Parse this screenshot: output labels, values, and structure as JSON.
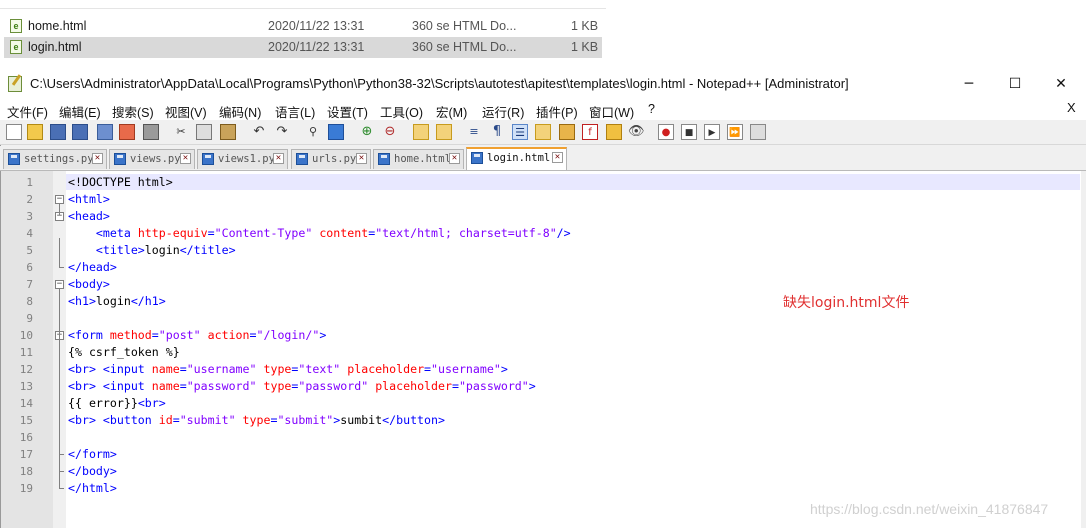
{
  "explorer": {
    "rows": [
      {
        "name": "home.html",
        "date": "2020/11/22 13:31",
        "type": "360 se HTML Do...",
        "size": "1 KB",
        "selected": false
      },
      {
        "name": "login.html",
        "date": "2020/11/22 13:31",
        "type": "360 se HTML Do...",
        "size": "1 KB",
        "selected": true
      }
    ],
    "file_icon_glyph": "e"
  },
  "window": {
    "title": "C:\\Users\\Administrator\\AppData\\Local\\Programs\\Python\\Python38-32\\Scripts\\autotest\\apitest\\templates\\login.html - Notepad++ [Administrator]",
    "minimize": "─",
    "maximize": "☐",
    "close": "✕"
  },
  "menu": {
    "items": [
      "文件(F)",
      "编辑(E)",
      "搜索(S)",
      "视图(V)",
      "编码(N)",
      "语言(L)",
      "设置(T)",
      "工具(O)",
      "宏(M)",
      "运行(R)",
      "插件(P)",
      "窗口(W)",
      "?"
    ],
    "close_label": "X"
  },
  "tabs": [
    {
      "label": "settings.py",
      "active": false
    },
    {
      "label": "views.py",
      "active": false
    },
    {
      "label": "views1.py",
      "active": false
    },
    {
      "label": "urls.py",
      "active": false
    },
    {
      "label": "home.html",
      "active": false
    },
    {
      "label": "login.html",
      "active": true
    }
  ],
  "tab_close_glyph": "✕",
  "editor": {
    "line_numbers": [
      "1",
      "2",
      "3",
      "4",
      "5",
      "6",
      "7",
      "8",
      "9",
      "10",
      "11",
      "12",
      "13",
      "14",
      "15",
      "16",
      "17",
      "18",
      "19"
    ],
    "lines": [
      [
        [
          "doc",
          "<!DOCTYPE html>"
        ]
      ],
      [
        [
          "tag",
          "<html>"
        ]
      ],
      [
        [
          "tag",
          "<head>"
        ]
      ],
      [
        [
          "txt",
          "    "
        ],
        [
          "tag",
          "<meta "
        ],
        [
          "attr",
          "http-equiv"
        ],
        [
          "tag",
          "="
        ],
        [
          "val",
          "\"Content-Type\""
        ],
        [
          "txt",
          " "
        ],
        [
          "attr",
          "content"
        ],
        [
          "tag",
          "="
        ],
        [
          "val",
          "\"text/html; charset=utf-8\""
        ],
        [
          "tag",
          "/>"
        ]
      ],
      [
        [
          "txt",
          "    "
        ],
        [
          "tag",
          "<title>"
        ],
        [
          "txt",
          "login"
        ],
        [
          "tag",
          "</title>"
        ]
      ],
      [
        [
          "tag",
          "</head>"
        ]
      ],
      [
        [
          "tag",
          "<body>"
        ]
      ],
      [
        [
          "tag",
          "<h1>"
        ],
        [
          "txt",
          "login"
        ],
        [
          "tag",
          "</h1>"
        ]
      ],
      [],
      [
        [
          "tag",
          "<form "
        ],
        [
          "attr",
          "method"
        ],
        [
          "tag",
          "="
        ],
        [
          "val",
          "\"post\""
        ],
        [
          "txt",
          " "
        ],
        [
          "attr",
          "action"
        ],
        [
          "tag",
          "="
        ],
        [
          "val",
          "\"/login/\""
        ],
        [
          "tag",
          ">"
        ]
      ],
      [
        [
          "txt",
          "{% csrf_token %}"
        ]
      ],
      [
        [
          "tag",
          "<br>"
        ],
        [
          "txt",
          " "
        ],
        [
          "tag",
          "<input "
        ],
        [
          "attr",
          "name"
        ],
        [
          "tag",
          "="
        ],
        [
          "val",
          "\"username\""
        ],
        [
          "txt",
          " "
        ],
        [
          "attr",
          "type"
        ],
        [
          "tag",
          "="
        ],
        [
          "val",
          "\"text\""
        ],
        [
          "txt",
          " "
        ],
        [
          "attr",
          "placeholder"
        ],
        [
          "tag",
          "="
        ],
        [
          "val",
          "\"username\""
        ],
        [
          "tag",
          ">"
        ]
      ],
      [
        [
          "tag",
          "<br>"
        ],
        [
          "txt",
          " "
        ],
        [
          "tag",
          "<input "
        ],
        [
          "attr",
          "name"
        ],
        [
          "tag",
          "="
        ],
        [
          "val",
          "\"password\""
        ],
        [
          "txt",
          " "
        ],
        [
          "attr",
          "type"
        ],
        [
          "tag",
          "="
        ],
        [
          "val",
          "\"password\""
        ],
        [
          "txt",
          " "
        ],
        [
          "attr",
          "placeholder"
        ],
        [
          "tag",
          "="
        ],
        [
          "val",
          "\"password\""
        ],
        [
          "tag",
          ">"
        ]
      ],
      [
        [
          "txt",
          "{{ error}}"
        ],
        [
          "tag",
          "<br>"
        ]
      ],
      [
        [
          "tag",
          "<br>"
        ],
        [
          "txt",
          " "
        ],
        [
          "tag",
          "<button "
        ],
        [
          "attr",
          "id"
        ],
        [
          "tag",
          "="
        ],
        [
          "val",
          "\"submit\""
        ],
        [
          "txt",
          " "
        ],
        [
          "attr",
          "type"
        ],
        [
          "tag",
          "="
        ],
        [
          "val",
          "\"submit\""
        ],
        [
          "tag",
          ">"
        ],
        [
          "txt",
          "sumbit"
        ],
        [
          "tag",
          "</button>"
        ]
      ],
      [],
      [
        [
          "tag",
          "</form>"
        ]
      ],
      [
        [
          "tag",
          "</body>"
        ]
      ],
      [
        [
          "tag",
          "</html>"
        ]
      ]
    ],
    "fold_markers": {
      "2": "open",
      "3": "open",
      "6": "end",
      "7": "open",
      "10": "open",
      "17": "end",
      "18": "end",
      "19": "end"
    }
  },
  "annotation": "缺失login.html文件",
  "watermark": "https://blog.csdn.net/weixin_41876847",
  "colors": {
    "tag": "#0000ff",
    "attr": "#ff0000",
    "value": "#8000ff",
    "annotation": "#e03030",
    "active_tab_accent": "#f0a030"
  }
}
